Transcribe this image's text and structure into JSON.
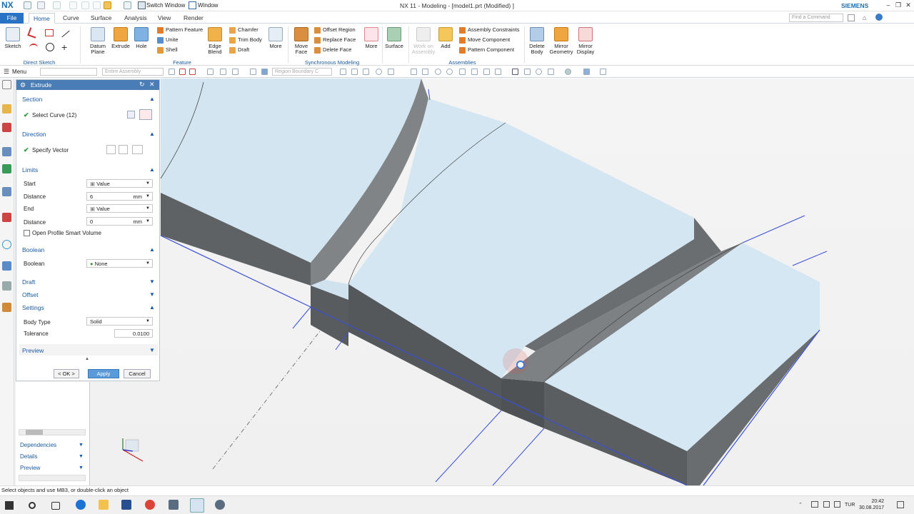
{
  "app": {
    "logo": "NX",
    "window_title": "NX 11 - Modeling - [model1.prt (Modified) ]",
    "brand": "SIEMENS",
    "switch_window": "Switch Window",
    "window_menu": "Window",
    "find_command_placeholder": "Find a Command"
  },
  "tabs": [
    "File",
    "Home",
    "Curve",
    "Surface",
    "Analysis",
    "View",
    "Render"
  ],
  "ribbon": {
    "direct_sketch": {
      "label": "Direct Sketch",
      "sketch": "Sketch"
    },
    "feature": {
      "label": "Feature",
      "datum_plane": "Datum Plane",
      "extrude": "Extrude",
      "hole": "Hole",
      "pattern_feature": "Pattern Feature",
      "unite": "Unite",
      "shell": "Shell",
      "edge_blend": "Edge Blend",
      "chamfer": "Chamfer",
      "trim_body": "Trim Body",
      "draft": "Draft",
      "more": "More"
    },
    "sync": {
      "label": "Synchronous Modeling",
      "move_face": "Move Face",
      "offset_region": "Offset Region",
      "replace_face": "Replace Face",
      "delete_face": "Delete Face",
      "more": "More"
    },
    "surface": "Surface",
    "assemblies": {
      "label": "Assemblies",
      "work_on_assembly": "Work on Assembly",
      "add": "Add",
      "assembly_constraints": "Assembly Constraints",
      "move_component": "Move Component",
      "pattern_component": "Pattern Component"
    },
    "delete_body": "Delete Body",
    "mirror_geometry": "Mirror Geometry",
    "mirror_display": "Mirror Display"
  },
  "toolbar2": {
    "menu": "Menu",
    "filter": "Entire Assembly",
    "region": "Region Boundary C"
  },
  "dialog": {
    "title": "Extrude",
    "section": "Section",
    "select_curve": "Select Curve (12)",
    "direction": "Direction",
    "specify_vector": "Specify Vector",
    "limits": "Limits",
    "start_label": "Start",
    "start_value": "Value",
    "distance_label": "Distance",
    "start_distance": "6",
    "unit": "mm",
    "end_label": "End",
    "end_value": "Value",
    "end_distance": "0",
    "open_profile": "Open Profile Smart Volume",
    "boolean_section": "Boolean",
    "boolean_label": "Boolean",
    "boolean_value": "None",
    "draft": "Draft",
    "offset": "Offset",
    "settings": "Settings",
    "body_type_label": "Body Type",
    "body_type_value": "Solid",
    "tolerance_label": "Tolerance",
    "tolerance_value": "0.0100",
    "preview": "Preview",
    "ok": "< OK >",
    "apply": "Apply",
    "cancel": "Cancel"
  },
  "lower_panel": {
    "dependencies": "Dependencies",
    "details": "Details",
    "preview": "Preview"
  },
  "status_text": "Select objects and use MB3, or double-click an object",
  "taskbar": {
    "lang": "TUR",
    "time": "20:42",
    "date": "30.08.2017"
  },
  "colors": {
    "accent": "#2a72c4",
    "model_face": "#d3e6f1",
    "model_side": "#5e6163",
    "edge_blue": "#3b4fd8",
    "viewport_bg": "#f2f2f2"
  }
}
